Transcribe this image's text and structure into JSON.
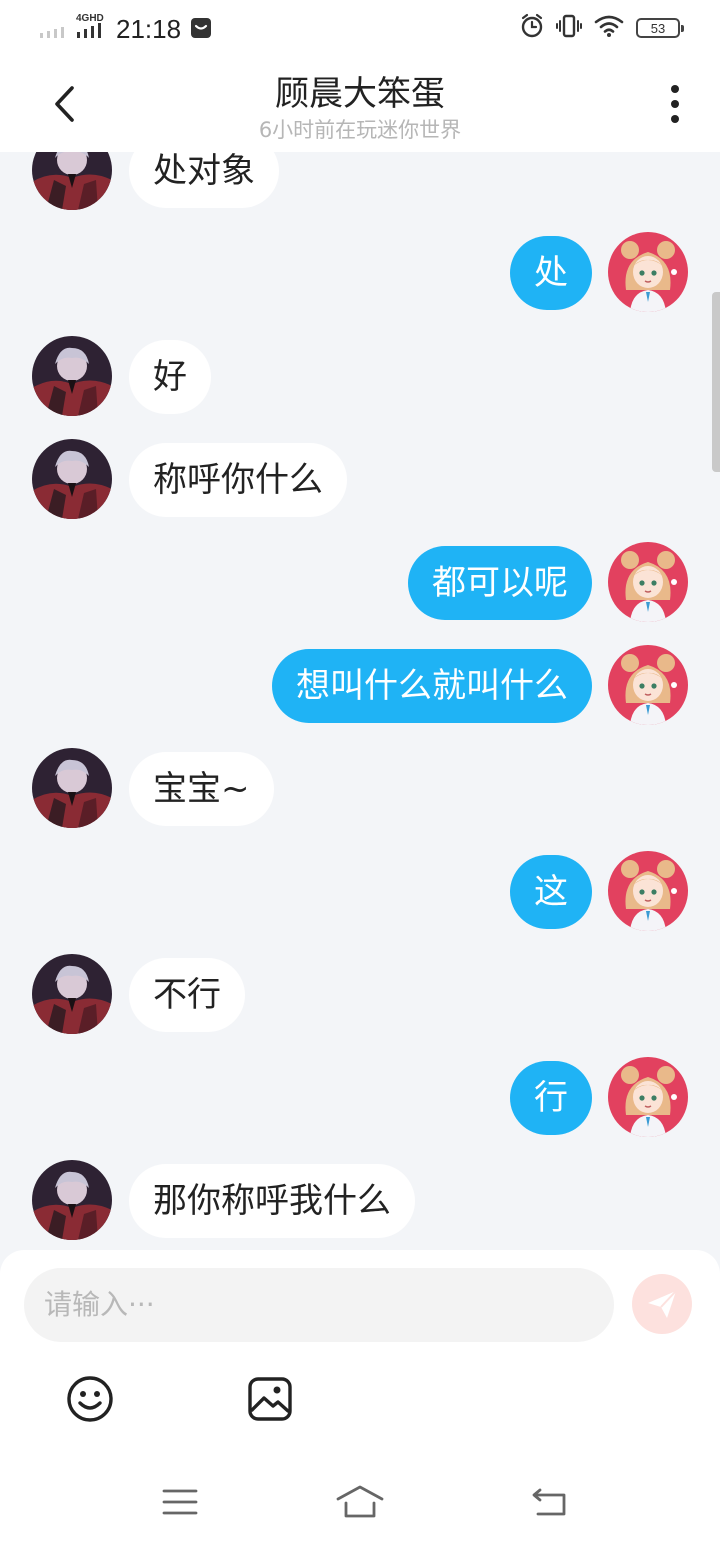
{
  "status_bar": {
    "network": "4GHD",
    "time": "21:18",
    "battery": "53"
  },
  "header": {
    "title": "顾晨大笨蛋",
    "subtitle": "6小时前在玩迷你世界"
  },
  "messages": [
    {
      "side": "left",
      "text": "处对象"
    },
    {
      "side": "right",
      "text": "处"
    },
    {
      "side": "left",
      "text": "好"
    },
    {
      "side": "left",
      "text": "称呼你什么"
    },
    {
      "side": "right",
      "text": "都可以呢"
    },
    {
      "side": "right",
      "text": "想叫什么就叫什么"
    },
    {
      "side": "left",
      "text": "宝宝~"
    },
    {
      "side": "right",
      "text": "这"
    },
    {
      "side": "left",
      "text": "不行"
    },
    {
      "side": "right",
      "text": "行"
    },
    {
      "side": "left",
      "text": "那你称呼我什么"
    }
  ],
  "input": {
    "placeholder": "请输入···"
  },
  "colors": {
    "outgoing_bubble": "#1fb3f5",
    "incoming_bubble": "#ffffff",
    "chat_background": "#f3f5f8",
    "send_button": "#fde1de"
  },
  "icons": {
    "back": "chevron-left-icon",
    "more": "more-vertical-icon",
    "send": "paper-plane-icon",
    "emoji": "smiley-icon",
    "image": "image-icon",
    "nav_menu": "menu-icon",
    "nav_home": "home-icon",
    "nav_back": "return-icon"
  }
}
